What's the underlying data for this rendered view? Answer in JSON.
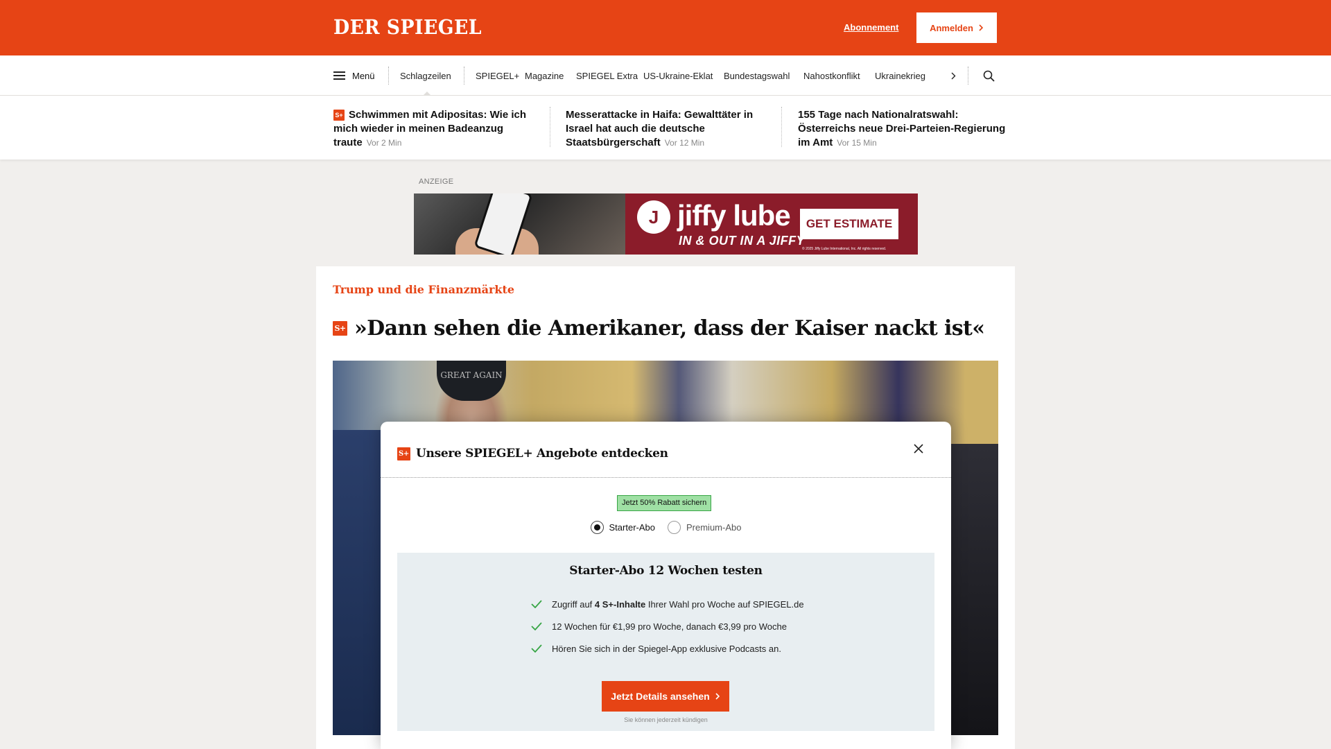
{
  "header": {
    "logo": "DER SPIEGEL",
    "abo_link": "Abonnement",
    "login_button": "Anmelden",
    "brand_color": "#e64415"
  },
  "nav": {
    "menu_label": "Menü",
    "items": [
      "Schlagzeilen",
      "SPIEGEL+",
      "Magazine",
      "SPIEGEL Extra",
      "US-Ukraine-Eklat",
      "Bundestagswahl",
      "Nahostkonflikt",
      "Ukrainekrieg"
    ],
    "more_icon": "chevron-right-icon",
    "search_icon": "search-icon"
  },
  "headlines": [
    {
      "plus": true,
      "title": "Schwimmen mit Adipositas: Wie ich mich wieder in meinen Badeanzug traute",
      "time": "Vor 2 Min"
    },
    {
      "plus": false,
      "title": "Messerattacke in Haifa: Gewalttäter in Israel hat auch die deutsche Staatsbürgerschaft",
      "time": "Vor 12 Min"
    },
    {
      "plus": false,
      "title": "155 Tage nach Nationalratswahl: Österreichs neue Drei-Parteien-Regierung im Amt",
      "time": "Vor 15 Min"
    }
  ],
  "ad": {
    "label": "ANZEIGE",
    "brand": "jiffy lube",
    "tagline": "IN & OUT IN A JIFFY",
    "cta": "GET ESTIMATE",
    "fine_print": "© 2025 Jiffy Lube International, Inc. All rights reserved.",
    "color": "#8b1c2a"
  },
  "article": {
    "kicker": "Trump und die Finanzmärkte",
    "plus_badge": "S+",
    "title": "»Dann sehen die Amerikaner, dass der Kaiser nackt ist«",
    "hero_cap_text": "GREAT AGAIN"
  },
  "modal": {
    "title": "Unsere SPIEGEL+ Angebote entdecken",
    "discount_badge": "Jetzt 50% Rabatt sichern",
    "options": [
      {
        "label": "Starter-Abo",
        "selected": true
      },
      {
        "label": "Premium-Abo",
        "selected": false
      }
    ],
    "offer_title": "Starter-Abo 12 Wochen testen",
    "benefit_1_pre": "Zugriff auf ",
    "benefit_1_bold": "4 S+-Inhalte",
    "benefit_1_post": " Ihrer Wahl pro Woche auf SPIEGEL.de",
    "benefit_2": "12 Wochen für €1,99 pro Woche, danach €3,99 pro Woche",
    "benefit_3": "Hören Sie sich in der Spiegel-App exklusive Podcasts an.",
    "cta": "Jetzt Details ansehen",
    "cancel_note": "Sie können jederzeit kündigen",
    "check_color": "#37a545"
  }
}
